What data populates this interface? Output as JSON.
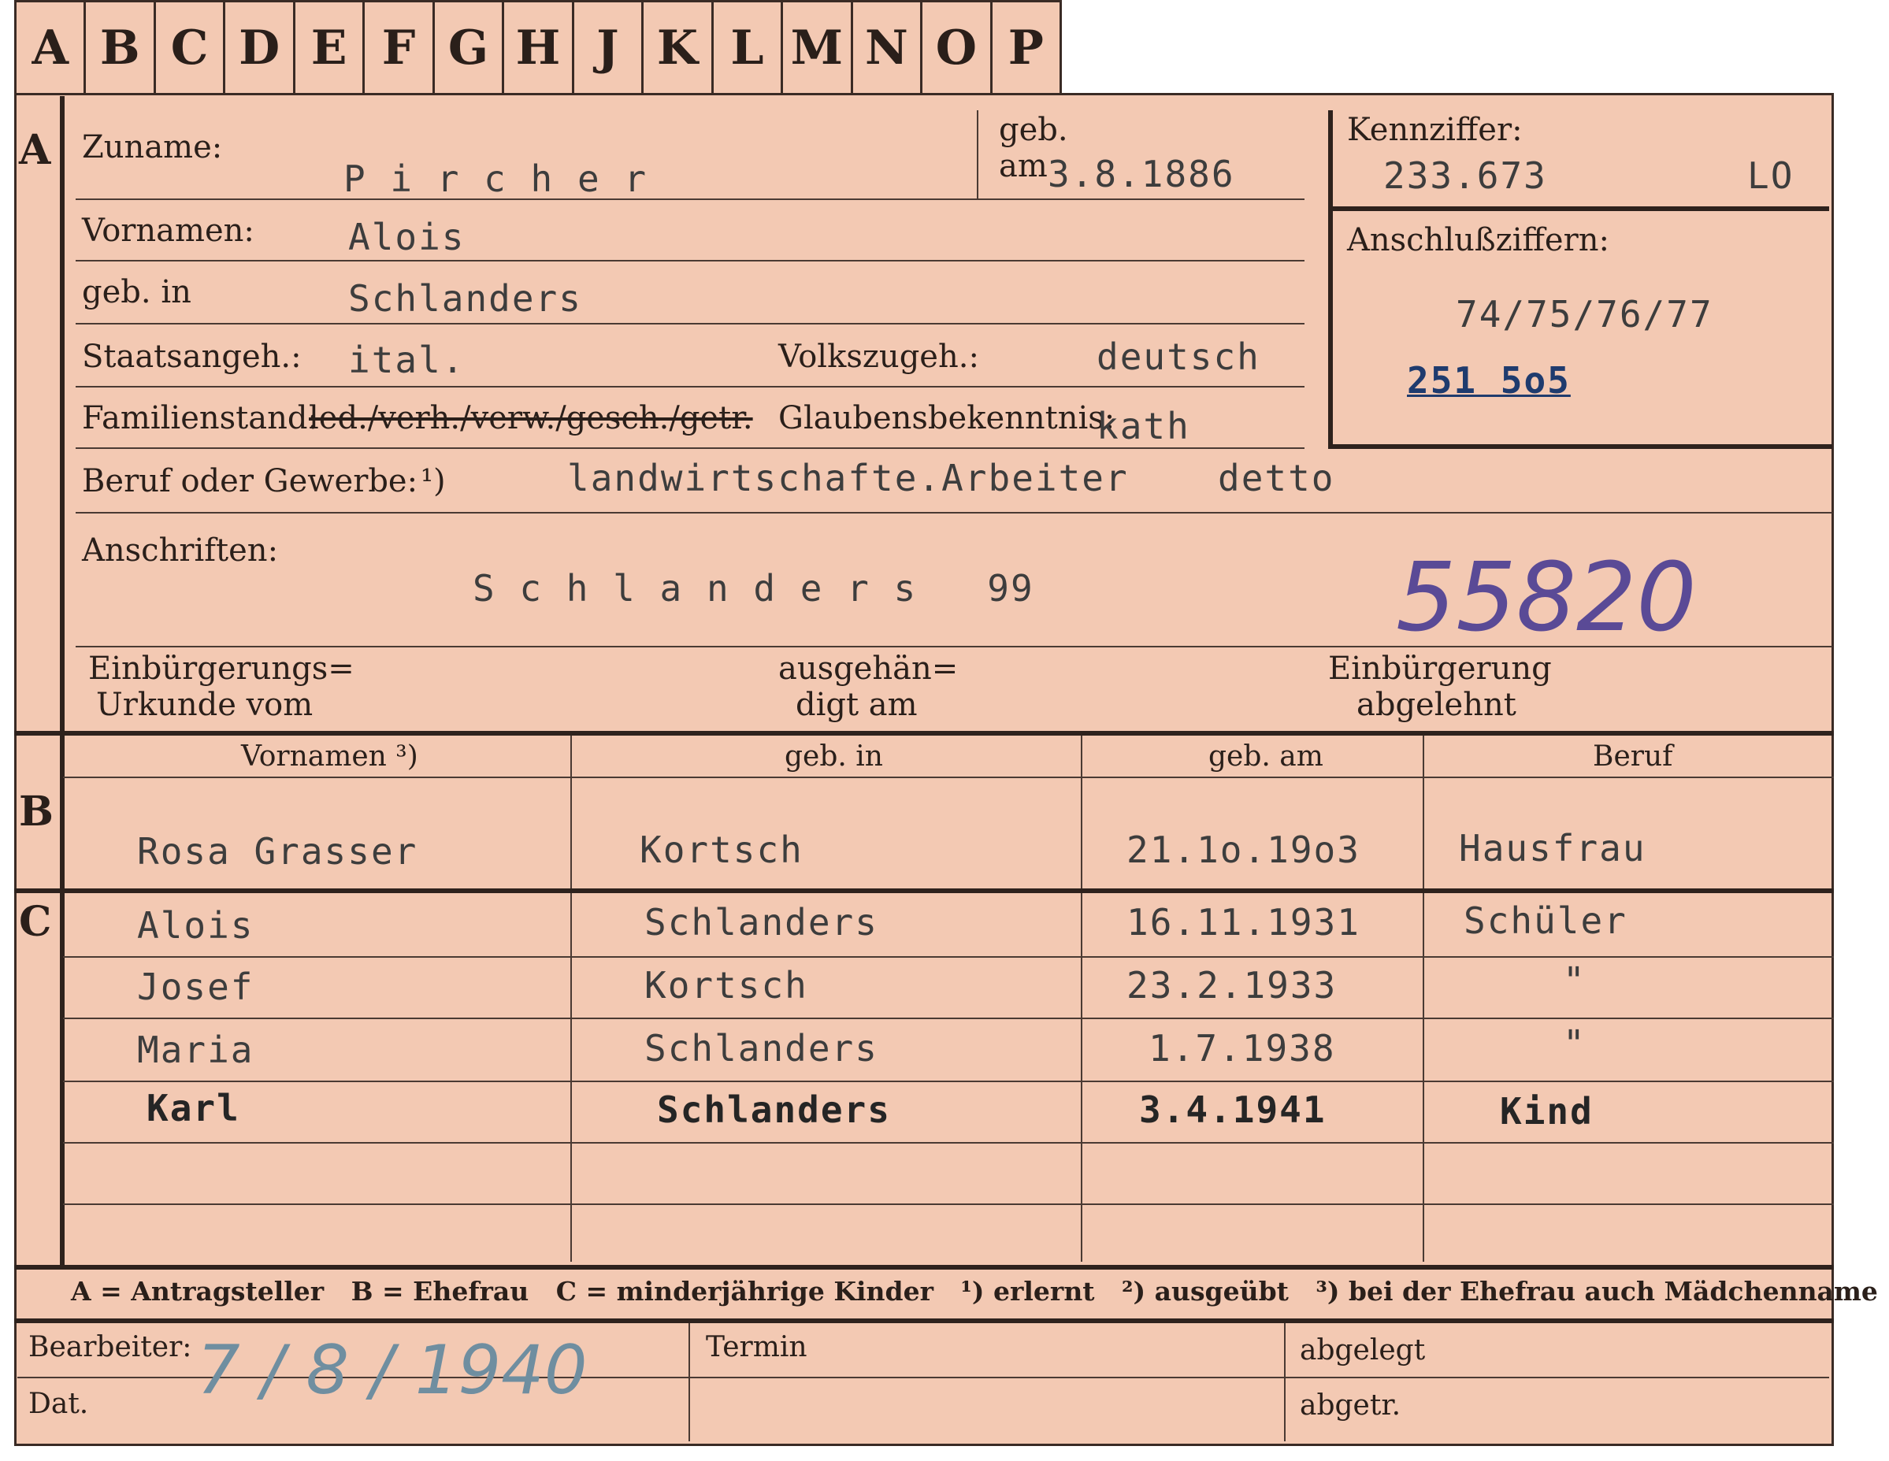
{
  "tabs": [
    "A",
    "B",
    "C",
    "D",
    "E",
    "F",
    "G",
    "H",
    "J",
    "K",
    "L",
    "M",
    "N",
    "O",
    "P"
  ],
  "section_a": {
    "marker": "A",
    "zuname_label": "Zuname:",
    "zuname_value": "P i r c h e r",
    "geb_label": "geb.",
    "am_label": "am",
    "geb_am_value": "3.8.1886",
    "vornamen_label": "Vornamen:",
    "vornamen_value": "Alois",
    "geb_in_label": "geb. in",
    "geb_in_value": "Schlanders",
    "staatsangeh_label": "Staatsangeh.:",
    "staatsangeh_value": "ital.",
    "volkszugeh_label": "Volkszugeh.:",
    "volkszugeh_value": "deutsch",
    "familienstand_label": "Familienstand:",
    "familienstand_options": "led./verh./verw./gesch./getr.",
    "glaubensbekenntnis_label": "Glaubensbekenntnis:",
    "glaubensbekenntnis_value": "kath",
    "beruf_label": "Beruf oder Gewerbe:",
    "beruf_note": "¹)",
    "beruf_value": "landwirtschafte.Arbeiter",
    "beruf_value_2": "detto",
    "anschriften_label": "Anschriften:",
    "anschriften_value": "S c h l a n d e r s   99",
    "handwritten_number": "55820",
    "einbuergerungs_label_1": "Einbürgerungs=",
    "einbuergerungs_label_2": "Urkunde vom",
    "ausgehaen_label_1": "ausgehän=",
    "ausgehaen_label_2": "digt am",
    "einbuergerung_label_1": "Einbürgerung",
    "einbuergerung_label_2": "abgelehnt"
  },
  "kennziffer": {
    "label": "Kennziffer:",
    "value": "233.673",
    "code": "LO",
    "anschluss_label": "Anschlußziffern:",
    "anschluss_value": "74/75/76/77",
    "anschluss_value_2": "251 5o5"
  },
  "section_b": {
    "marker": "B",
    "headers": [
      "Vornamen ³)",
      "geb. in",
      "geb. am",
      "Beruf"
    ],
    "row": [
      "Rosa Grasser",
      "Kortsch",
      "21.1o.19o3",
      "Hausfrau"
    ]
  },
  "section_c": {
    "marker": "C",
    "rows": [
      [
        "Alois",
        "Schlanders",
        "16.11.1931",
        "Schüler"
      ],
      [
        "Josef",
        "Kortsch",
        "23.2.1933",
        "\""
      ],
      [
        "Maria",
        "Schlanders",
        "1.7.1938",
        "\""
      ],
      [
        "Karl",
        "Schlanders",
        "3.4.1941",
        "Kind"
      ]
    ]
  },
  "legend": "A = Antragsteller   B = Ehefrau   C = minderjährige Kinder   ¹) erlernt   ²) ausgeübt   ³) bei der Ehefrau auch Mädchenname",
  "footer": {
    "bearbeiter_label": "Bearbeiter:",
    "dat_label": "Dat.",
    "date_handwritten": "7 / 8 / 1940",
    "termin_label": "Termin",
    "abgelegt_label": "abgelegt",
    "abgetr_label": "abgetr."
  },
  "colors": {
    "card": "#f3c9b3",
    "ink_violet": "#5a4a96",
    "ink_pencil": "#6f8ea0"
  }
}
